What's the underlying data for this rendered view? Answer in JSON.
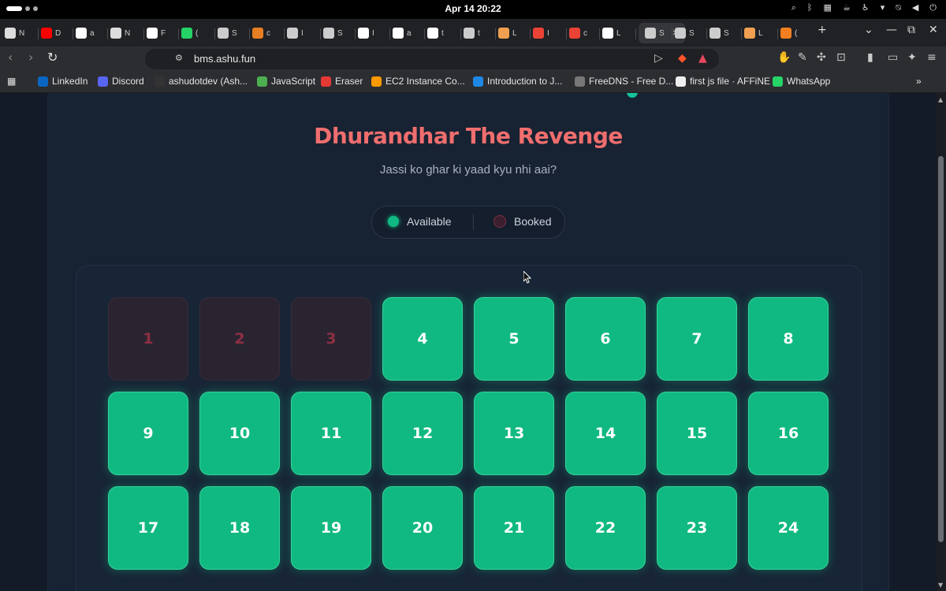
{
  "os": {
    "clock": "Apr 14  20:22"
  },
  "tabs": [
    {
      "icon": "ollama-icon",
      "label": "N",
      "color": "#ddd"
    },
    {
      "icon": "youtube-icon",
      "label": "D",
      "color": "#ff0000"
    },
    {
      "icon": "github-icon",
      "label": "a",
      "color": "#fff"
    },
    {
      "icon": "ollama-icon",
      "label": "N",
      "color": "#ddd"
    },
    {
      "icon": "workflow-icon",
      "label": "F",
      "color": "#fff"
    },
    {
      "icon": "whatsapp-icon",
      "label": "(",
      "color": "#25d366"
    },
    {
      "icon": "globe-icon",
      "label": "S",
      "color": "#ccc"
    },
    {
      "icon": "gamepad-icon",
      "label": "c",
      "color": "#e67e22"
    },
    {
      "icon": "globe-icon",
      "label": "I",
      "color": "#ccc"
    },
    {
      "icon": "globe-icon",
      "label": "S",
      "color": "#ccc"
    },
    {
      "icon": "openai-icon",
      "label": "I",
      "color": "#fff"
    },
    {
      "icon": "workflow-icon",
      "label": "a",
      "color": "#fff"
    },
    {
      "icon": "workflow-icon",
      "label": "t",
      "color": "#fff"
    },
    {
      "icon": "globe-icon",
      "label": "t",
      "color": "#ccc"
    },
    {
      "icon": "hand-icon",
      "label": "L",
      "color": "#f0a050"
    },
    {
      "icon": "gmail-icon",
      "label": "I",
      "color": "#ea4335"
    },
    {
      "icon": "gmail-icon",
      "label": "c",
      "color": "#ea4335"
    },
    {
      "icon": "vercel-icon",
      "label": "L",
      "color": "#fff"
    },
    {
      "icon": "page-icon",
      "label": "S",
      "color": "#ccc",
      "active": true
    },
    {
      "icon": "globe-icon",
      "label": "S",
      "color": "#ccc"
    },
    {
      "icon": "globe-icon",
      "label": "S",
      "color": "#ccc"
    },
    {
      "icon": "hand-icon",
      "label": "L",
      "color": "#f0a050"
    },
    {
      "icon": "cloudflare-icon",
      "label": "(",
      "color": "#f38020"
    }
  ],
  "toolbar": {
    "url": "bms.ashu.fun"
  },
  "bookmarks": [
    {
      "icon": "linkedin-icon",
      "label": "LinkedIn",
      "color": "#0a66c2"
    },
    {
      "icon": "discord-icon",
      "label": "Discord",
      "color": "#5865f2"
    },
    {
      "icon": "github-icon",
      "label": "ashudotdev (Ash...",
      "color": "#333"
    },
    {
      "icon": "leaf-icon",
      "label": "JavaScript",
      "color": "#4caf50"
    },
    {
      "icon": "eraser-icon",
      "label": "Eraser",
      "color": "#e53935"
    },
    {
      "icon": "aws-icon",
      "label": "EC2 Instance Co...",
      "color": "#ff9900"
    },
    {
      "icon": "s-icon",
      "label": "Introduction to J...",
      "color": "#1e88e5"
    },
    {
      "icon": "globe-icon",
      "label": "FreeDNS - Free D...",
      "color": "#777"
    },
    {
      "icon": "affine-icon",
      "label": "first js file · AFFiNE",
      "color": "#eee"
    },
    {
      "icon": "whatsapp-icon",
      "label": "WhatsApp",
      "color": "#25d366"
    }
  ],
  "page": {
    "title": "Dhurandhar The Revenge",
    "subtitle": "Jassi ko ghar ki yaad kyu nhi aai?",
    "legend": {
      "available": "Available",
      "booked": "Booked"
    },
    "seats": [
      {
        "n": "1",
        "status": "booked"
      },
      {
        "n": "2",
        "status": "booked"
      },
      {
        "n": "3",
        "status": "booked"
      },
      {
        "n": "4",
        "status": "available"
      },
      {
        "n": "5",
        "status": "available"
      },
      {
        "n": "6",
        "status": "available"
      },
      {
        "n": "7",
        "status": "available"
      },
      {
        "n": "8",
        "status": "available"
      },
      {
        "n": "9",
        "status": "available"
      },
      {
        "n": "10",
        "status": "available"
      },
      {
        "n": "11",
        "status": "available"
      },
      {
        "n": "12",
        "status": "available"
      },
      {
        "n": "13",
        "status": "available"
      },
      {
        "n": "14",
        "status": "available"
      },
      {
        "n": "15",
        "status": "available"
      },
      {
        "n": "16",
        "status": "available"
      },
      {
        "n": "17",
        "status": "available"
      },
      {
        "n": "18",
        "status": "available"
      },
      {
        "n": "19",
        "status": "available"
      },
      {
        "n": "20",
        "status": "available"
      },
      {
        "n": "21",
        "status": "available"
      },
      {
        "n": "22",
        "status": "available"
      },
      {
        "n": "23",
        "status": "available"
      },
      {
        "n": "24",
        "status": "available"
      }
    ]
  },
  "colors": {
    "accent_title": "#ef6e6e",
    "available": "#10b981",
    "booked": "#2a2431"
  }
}
